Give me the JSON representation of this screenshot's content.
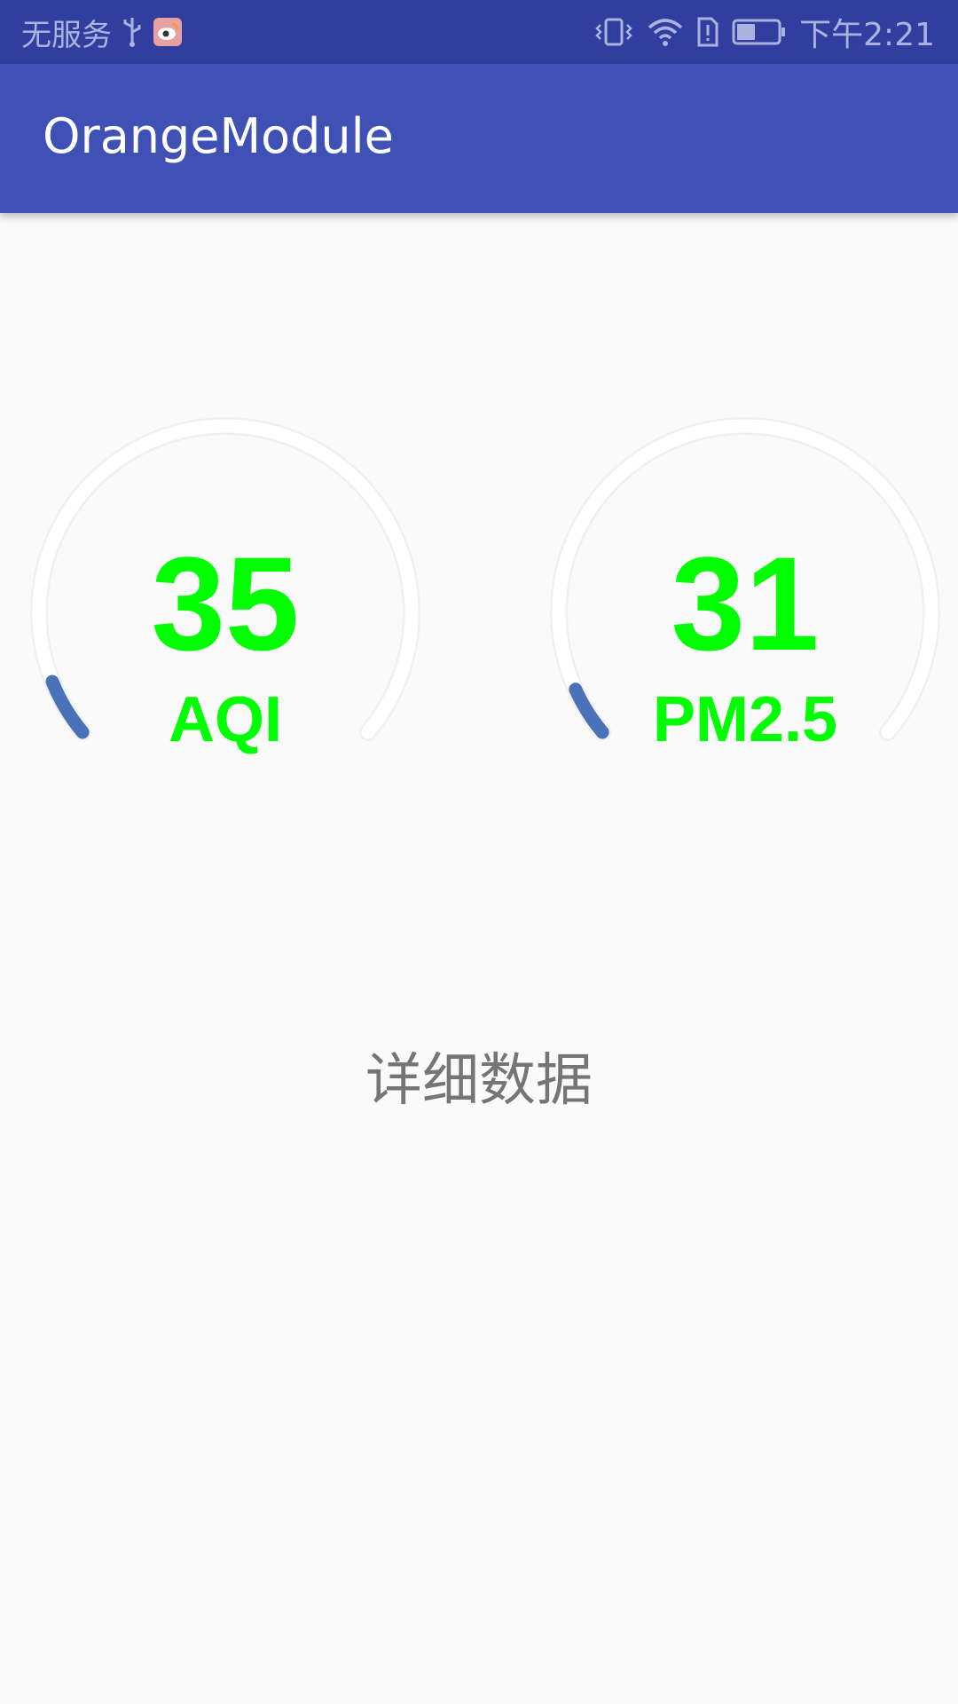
{
  "status_bar": {
    "carrier": "无服务",
    "time": "下午2:21",
    "icons": [
      "usb-icon",
      "weibo-app-icon",
      "vibrate-icon",
      "wifi-icon",
      "sim-alert-icon",
      "battery-icon"
    ]
  },
  "app_bar": {
    "title": "OrangeModule",
    "background": "#3f51b5",
    "status_background": "#303f9f"
  },
  "gauges": [
    {
      "id": "aqi",
      "value": "35",
      "label": "AQI",
      "progress_fraction": 0.07,
      "value_color": "#00ff00",
      "progress_color": "#4a72b8",
      "track_color": "#ffffff"
    },
    {
      "id": "pm25",
      "value": "31",
      "label": "PM2.5",
      "progress_fraction": 0.06,
      "value_color": "#00ff00",
      "progress_color": "#4a72b8",
      "track_color": "#ffffff"
    }
  ],
  "detail": {
    "label": "详细数据"
  }
}
